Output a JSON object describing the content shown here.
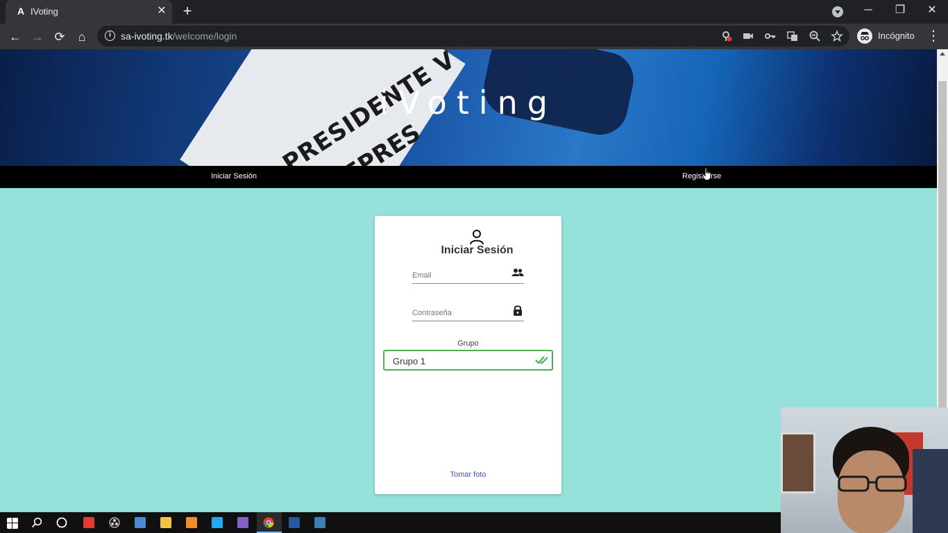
{
  "browser": {
    "tab_title": "IVoting",
    "tab_logo": "A",
    "close_glyph": "✕",
    "newtab_glyph": "+",
    "url_host": "sa-ivoting.tk",
    "url_path": "/welcome/login",
    "incognito_label": "Incógnito",
    "window_controls": {
      "minimize": "─",
      "restore": "❐",
      "close": "✕"
    },
    "nav": {
      "back": "←",
      "forward": "→",
      "reload": "⟳",
      "home": "⌂"
    }
  },
  "page": {
    "hero_title": "iVoting",
    "ballot_text_line1": "PRESIDENTE V",
    "ballot_text_line2": "EPRES",
    "nav": {
      "login": "Iniciar Sesión",
      "register": "Registrarse"
    },
    "login_card": {
      "title": "Iniciar Sesión",
      "email_label": "Email",
      "password_label": "Contraseña",
      "group_label": "Grupo",
      "group_value": "Grupo 1",
      "photo_button": "Tomar foto"
    }
  },
  "colors": {
    "page_background": "#96e1da",
    "navbar": "#000000",
    "select_border": "#4caf50",
    "link": "#3f51b5"
  },
  "taskbar": {
    "items": [
      {
        "name": "start-icon",
        "color": "#ffffff"
      },
      {
        "name": "search-icon",
        "color": "#ffffff"
      },
      {
        "name": "cortana-icon",
        "color": "#ffffff"
      },
      {
        "name": "anydesk-icon",
        "color": "#e53935"
      },
      {
        "name": "obs-icon",
        "color": "#cfcfcf"
      },
      {
        "name": "virtualbox-icon",
        "color": "#4b8ad6"
      },
      {
        "name": "file-explorer-icon",
        "color": "#f6c343"
      },
      {
        "name": "sublime-icon",
        "color": "#f28c28"
      },
      {
        "name": "vscode-icon",
        "color": "#23a9f2"
      },
      {
        "name": "visual-studio-icon",
        "color": "#8661c5"
      },
      {
        "name": "chrome-icon",
        "color": "#4caf50"
      },
      {
        "name": "word-icon",
        "color": "#2b579a"
      },
      {
        "name": "mysql-workbench-icon",
        "color": "#3d7fb3"
      }
    ]
  }
}
